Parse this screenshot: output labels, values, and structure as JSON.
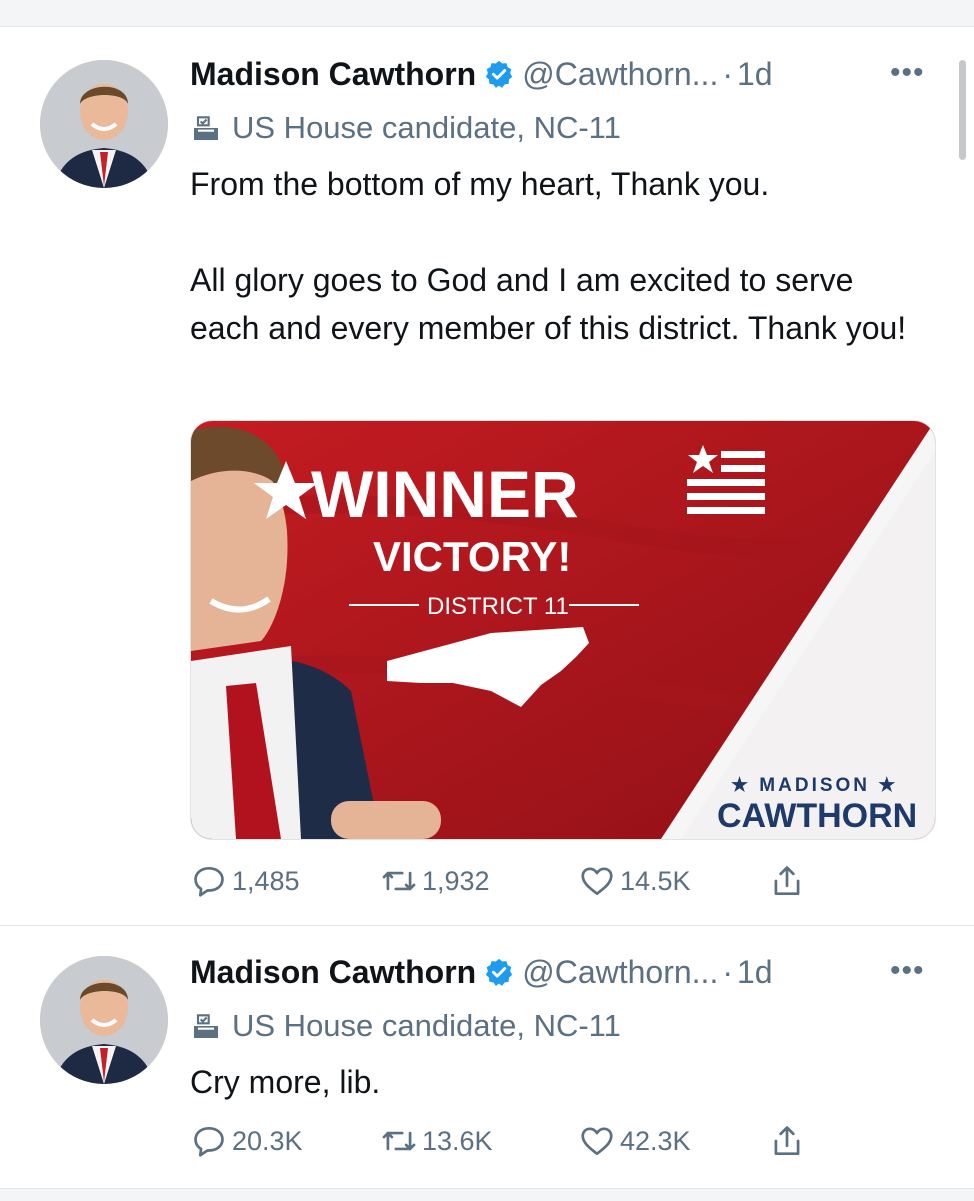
{
  "tweets": [
    {
      "author": "Madison Cawthorn",
      "handle": "@Cawthorn...",
      "separator": "·",
      "time": "1d",
      "more": "•••",
      "label": "US House candidate, NC-11",
      "text": [
        "From the bottom of my heart, Thank you.",
        "",
        "All glory goes to God and I am excited to serve each and every member of this district. Thank you!"
      ],
      "media": {
        "headline": "WINNER",
        "subhead": "VICTORY!",
        "district": "DISTRICT 11",
        "brand_top": "★ MADISON ★",
        "brand_name": "CAWTHORN"
      },
      "replies": "1,485",
      "retweets": "1,932",
      "likes": "14.5K"
    },
    {
      "author": "Madison Cawthorn",
      "handle": "@Cawthorn...",
      "separator": "·",
      "time": "1d",
      "more": "•••",
      "label": "US House candidate, NC-11",
      "text": [
        "Cry more, lib."
      ],
      "replies": "20.3K",
      "retweets": "13.6K",
      "likes": "42.3K"
    }
  ],
  "icons": {
    "verified": "verified-badge-icon",
    "label": "ballot-box-icon",
    "reply": "reply-icon",
    "retweet": "retweet-icon",
    "like": "heart-icon",
    "share": "share-icon"
  },
  "colors": {
    "verified": "#1d9bf0",
    "muted": "#5b7083",
    "red": "#b1151b",
    "navy": "#1d3a6b"
  }
}
